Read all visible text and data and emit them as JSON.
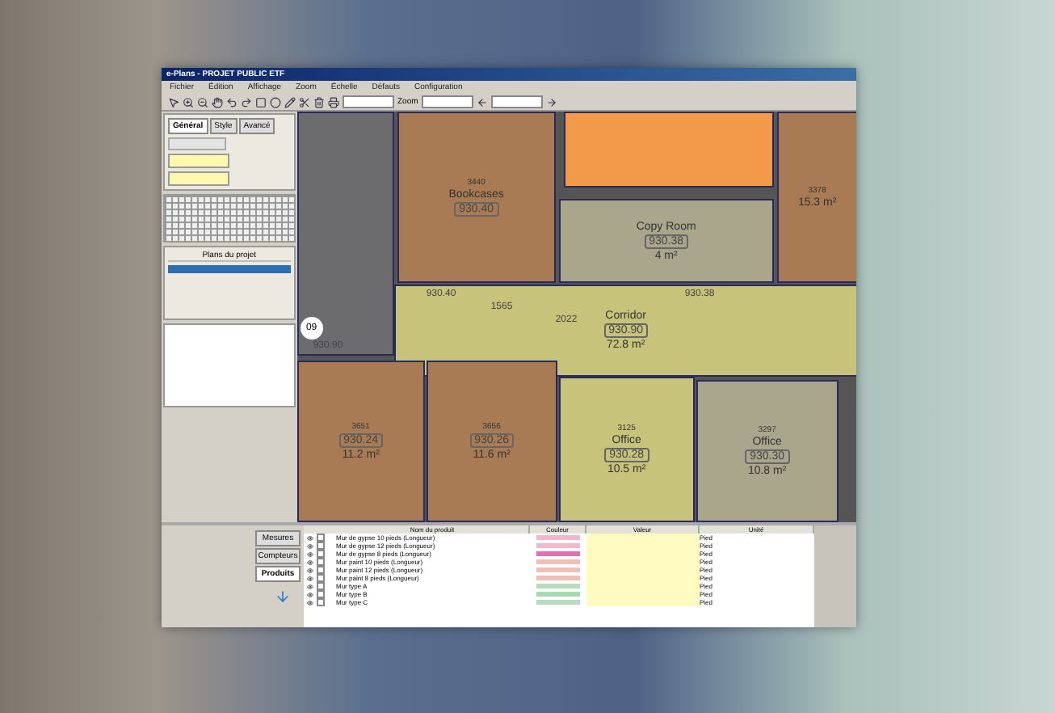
{
  "window": {
    "title": "e-Plans - PROJET PUBLIC ETF"
  },
  "menu": [
    "Fichier",
    "Édition",
    "Affichage",
    "Zoom",
    "Échelle",
    "Défauts",
    "Configuration"
  ],
  "toolbar": {
    "zoom_label": "Zoom"
  },
  "side_panel": {
    "tabs": [
      {
        "label": "Général",
        "selected": true
      },
      {
        "label": "Style",
        "selected": false
      },
      {
        "label": "Avancé",
        "selected": false
      }
    ],
    "plans_title": "Plans du projet"
  },
  "floor_plan": {
    "marker": "09",
    "corridor_labels": [
      "930.40",
      "930.38",
      "930.90",
      "1565",
      "2022"
    ],
    "rooms": [
      {
        "color": "#6c6c6e"
      },
      {
        "color": "#a97b55",
        "name": "Bookcases",
        "elevation": "930.40",
        "number": "3440"
      },
      {
        "color": "#f39a4a"
      },
      {
        "color": "#aaa68c",
        "name": "Copy Room",
        "elevation": "930.38",
        "area": "4 m²"
      },
      {
        "color": "#a97b55",
        "area": "15.3 m²",
        "number": "3378"
      },
      {
        "color": "#c8c37a",
        "name": "Corridor",
        "elevation": "930.90",
        "area": "72.8 m²"
      },
      {
        "color": "#a97b55",
        "number": "3651",
        "elevation": "930.24",
        "area": "11.2 m²"
      },
      {
        "color": "#a97b55",
        "number": "3656",
        "elevation": "930.26",
        "area": "11.6 m²"
      },
      {
        "color": "#c8c37a",
        "number": "3125",
        "name": "Office",
        "elevation": "930.28",
        "area": "10.5 m²"
      },
      {
        "color": "#aaa68c",
        "number": "3297",
        "name": "Office",
        "elevation": "930.30",
        "area": "10.8 m²"
      }
    ]
  },
  "bottom_panel": {
    "tabs": [
      {
        "label": "Mesures",
        "selected": false
      },
      {
        "label": "Compteurs",
        "selected": false
      },
      {
        "label": "Produits",
        "selected": true
      }
    ],
    "columns": [
      "Nom du produit",
      "Couleur",
      "Valeur",
      "Unité"
    ],
    "rows": [
      {
        "name": "Mur de gypse 10 pieds (Longueur)",
        "color": "#f0b8c8",
        "unit": "Pied",
        "checked": false
      },
      {
        "name": "Mur de gypse 12 pieds (Longueur)",
        "color": "#f0b8c8",
        "unit": "Pied",
        "checked": false
      },
      {
        "name": "Mur de gypse 8 pieds (Longueur)",
        "color": "#e070b0",
        "unit": "Pied",
        "checked": false
      },
      {
        "name": "Mur paint 10 pieds (Longueur)",
        "color": "#f0c0b8",
        "unit": "Pied",
        "checked": false
      },
      {
        "name": "Mur paint 12 pieds (Longueur)",
        "color": "#f0c0b8",
        "unit": "Pied",
        "checked": false
      },
      {
        "name": "Mur paint 8 pieds (Longueur)",
        "color": "#f0c0b8",
        "unit": "Pied",
        "checked": false
      },
      {
        "name": "Mur type A",
        "color": "#b8dcc0",
        "unit": "Pied",
        "checked": false
      },
      {
        "name": "Mur type B",
        "color": "#a8d8b0",
        "unit": "Pied",
        "checked": false
      },
      {
        "name": "Mur type C",
        "color": "#b8dcc0",
        "unit": "Pied",
        "checked": false
      }
    ]
  }
}
